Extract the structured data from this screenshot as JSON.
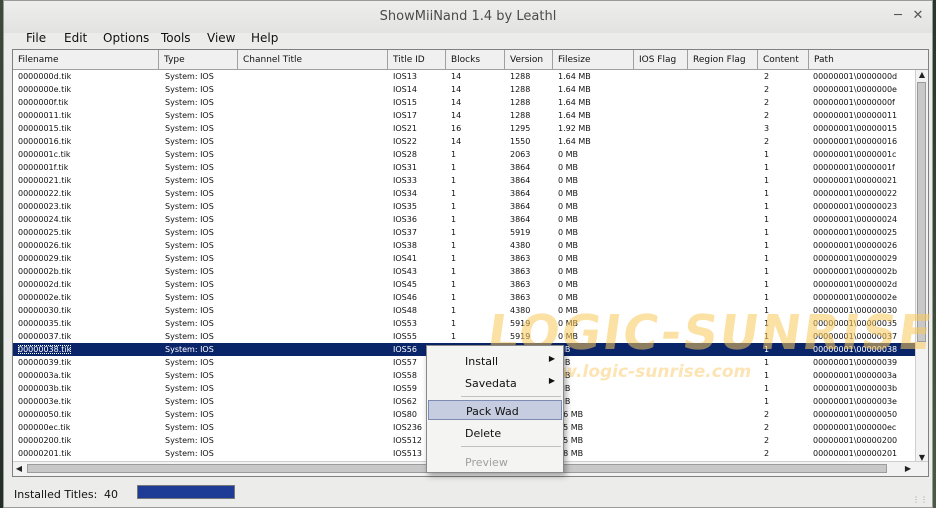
{
  "window": {
    "title": "ShowMiiNand 1.4 by Leathl"
  },
  "menu": [
    "File",
    "Edit",
    "Options",
    "Tools",
    "View",
    "Help"
  ],
  "columns": [
    "Filename",
    "Type",
    "Channel Title",
    "Title ID",
    "Blocks",
    "Version",
    "Filesize",
    "IOS Flag",
    "Region Flag",
    "Content",
    "Path"
  ],
  "rows": [
    {
      "f": "0000000d.tik",
      "t": "System: IOS",
      "ch": "",
      "id": "IOS13",
      "b": "14",
      "v": "1288",
      "s": "1.64 MB",
      "ios": "",
      "reg": "",
      "c": "2",
      "p": "00000001\\0000000d"
    },
    {
      "f": "0000000e.tik",
      "t": "System: IOS",
      "ch": "",
      "id": "IOS14",
      "b": "14",
      "v": "1288",
      "s": "1.64 MB",
      "ios": "",
      "reg": "",
      "c": "2",
      "p": "00000001\\0000000e"
    },
    {
      "f": "0000000f.tik",
      "t": "System: IOS",
      "ch": "",
      "id": "IOS15",
      "b": "14",
      "v": "1288",
      "s": "1.64 MB",
      "ios": "",
      "reg": "",
      "c": "2",
      "p": "00000001\\0000000f"
    },
    {
      "f": "00000011.tik",
      "t": "System: IOS",
      "ch": "",
      "id": "IOS17",
      "b": "14",
      "v": "1288",
      "s": "1.64 MB",
      "ios": "",
      "reg": "",
      "c": "2",
      "p": "00000001\\00000011"
    },
    {
      "f": "00000015.tik",
      "t": "System: IOS",
      "ch": "",
      "id": "IOS21",
      "b": "16",
      "v": "1295",
      "s": "1.92 MB",
      "ios": "",
      "reg": "",
      "c": "3",
      "p": "00000001\\00000015"
    },
    {
      "f": "00000016.tik",
      "t": "System: IOS",
      "ch": "",
      "id": "IOS22",
      "b": "14",
      "v": "1550",
      "s": "1.64 MB",
      "ios": "",
      "reg": "",
      "c": "2",
      "p": "00000001\\00000016"
    },
    {
      "f": "0000001c.tik",
      "t": "System: IOS",
      "ch": "",
      "id": "IOS28",
      "b": "1",
      "v": "2063",
      "s": "0 MB",
      "ios": "",
      "reg": "",
      "c": "1",
      "p": "00000001\\0000001c"
    },
    {
      "f": "0000001f.tik",
      "t": "System: IOS",
      "ch": "",
      "id": "IOS31",
      "b": "1",
      "v": "3864",
      "s": "0 MB",
      "ios": "",
      "reg": "",
      "c": "1",
      "p": "00000001\\0000001f"
    },
    {
      "f": "00000021.tik",
      "t": "System: IOS",
      "ch": "",
      "id": "IOS33",
      "b": "1",
      "v": "3864",
      "s": "0 MB",
      "ios": "",
      "reg": "",
      "c": "1",
      "p": "00000001\\00000021"
    },
    {
      "f": "00000022.tik",
      "t": "System: IOS",
      "ch": "",
      "id": "IOS34",
      "b": "1",
      "v": "3864",
      "s": "0 MB",
      "ios": "",
      "reg": "",
      "c": "1",
      "p": "00000001\\00000022"
    },
    {
      "f": "00000023.tik",
      "t": "System: IOS",
      "ch": "",
      "id": "IOS35",
      "b": "1",
      "v": "3864",
      "s": "0 MB",
      "ios": "",
      "reg": "",
      "c": "1",
      "p": "00000001\\00000023"
    },
    {
      "f": "00000024.tik",
      "t": "System: IOS",
      "ch": "",
      "id": "IOS36",
      "b": "1",
      "v": "3864",
      "s": "0 MB",
      "ios": "",
      "reg": "",
      "c": "1",
      "p": "00000001\\00000024"
    },
    {
      "f": "00000025.tik",
      "t": "System: IOS",
      "ch": "",
      "id": "IOS37",
      "b": "1",
      "v": "5919",
      "s": "0 MB",
      "ios": "",
      "reg": "",
      "c": "1",
      "p": "00000001\\00000025"
    },
    {
      "f": "00000026.tik",
      "t": "System: IOS",
      "ch": "",
      "id": "IOS38",
      "b": "1",
      "v": "4380",
      "s": "0 MB",
      "ios": "",
      "reg": "",
      "c": "1",
      "p": "00000001\\00000026"
    },
    {
      "f": "00000029.tik",
      "t": "System: IOS",
      "ch": "",
      "id": "IOS41",
      "b": "1",
      "v": "3863",
      "s": "0 MB",
      "ios": "",
      "reg": "",
      "c": "1",
      "p": "00000001\\00000029"
    },
    {
      "f": "0000002b.tik",
      "t": "System: IOS",
      "ch": "",
      "id": "IOS43",
      "b": "1",
      "v": "3863",
      "s": "0 MB",
      "ios": "",
      "reg": "",
      "c": "1",
      "p": "00000001\\0000002b"
    },
    {
      "f": "0000002d.tik",
      "t": "System: IOS",
      "ch": "",
      "id": "IOS45",
      "b": "1",
      "v": "3863",
      "s": "0 MB",
      "ios": "",
      "reg": "",
      "c": "1",
      "p": "00000001\\0000002d"
    },
    {
      "f": "0000002e.tik",
      "t": "System: IOS",
      "ch": "",
      "id": "IOS46",
      "b": "1",
      "v": "3863",
      "s": "0 MB",
      "ios": "",
      "reg": "",
      "c": "1",
      "p": "00000001\\0000002e"
    },
    {
      "f": "00000030.tik",
      "t": "System: IOS",
      "ch": "",
      "id": "IOS48",
      "b": "1",
      "v": "4380",
      "s": "0 MB",
      "ios": "",
      "reg": "",
      "c": "1",
      "p": "00000001\\00000030"
    },
    {
      "f": "00000035.tik",
      "t": "System: IOS",
      "ch": "",
      "id": "IOS53",
      "b": "1",
      "v": "5919",
      "s": "0 MB",
      "ios": "",
      "reg": "",
      "c": "1",
      "p": "00000001\\00000035"
    },
    {
      "f": "00000037.tik",
      "t": "System: IOS",
      "ch": "",
      "id": "IOS55",
      "b": "1",
      "v": "5919",
      "s": "0 MB",
      "ios": "",
      "reg": "",
      "c": "1",
      "p": "00000001\\00000037"
    },
    {
      "f": "00000038.tik",
      "t": "System: IOS",
      "ch": "",
      "id": "IOS56",
      "b": "",
      "v": "",
      "s": "MB",
      "ios": "",
      "reg": "",
      "c": "1",
      "p": "00000001\\00000038",
      "sel": true
    },
    {
      "f": "00000039.tik",
      "t": "System: IOS",
      "ch": "",
      "id": "IOS57",
      "b": "",
      "v": "",
      "s": "MB",
      "ios": "",
      "reg": "",
      "c": "1",
      "p": "00000001\\00000039"
    },
    {
      "f": "0000003a.tik",
      "t": "System: IOS",
      "ch": "",
      "id": "IOS58",
      "b": "",
      "v": "",
      "s": "MB",
      "ios": "",
      "reg": "",
      "c": "1",
      "p": "00000001\\0000003a"
    },
    {
      "f": "0000003b.tik",
      "t": "System: IOS",
      "ch": "",
      "id": "IOS59",
      "b": "",
      "v": "",
      "s": "MB",
      "ios": "",
      "reg": "",
      "c": "1",
      "p": "00000001\\0000003b"
    },
    {
      "f": "0000003e.tik",
      "t": "System: IOS",
      "ch": "",
      "id": "IOS62",
      "b": "",
      "v": "",
      "s": "MB",
      "ios": "",
      "reg": "",
      "c": "1",
      "p": "00000001\\0000003e"
    },
    {
      "f": "00000050.tik",
      "t": "System: IOS",
      "ch": "",
      "id": "IOS80",
      "b": "",
      "v": "",
      "s": "16 MB",
      "ios": "",
      "reg": "",
      "c": "2",
      "p": "00000001\\00000050"
    },
    {
      "f": "000000ec.tik",
      "t": "System: IOS",
      "ch": "",
      "id": "IOS236",
      "b": "",
      "v": "",
      "s": "15 MB",
      "ios": "",
      "reg": "",
      "c": "2",
      "p": "00000001\\000000ec"
    },
    {
      "f": "00000200.tik",
      "t": "System: IOS",
      "ch": "",
      "id": "IOS512",
      "b": "",
      "v": "",
      "s": "25 MB",
      "ios": "",
      "reg": "",
      "c": "2",
      "p": "00000001\\00000200"
    },
    {
      "f": "00000201.tik",
      "t": "System: IOS",
      "ch": "",
      "id": "IOS513",
      "b": "",
      "v": "",
      "s": "58 MB",
      "ios": "",
      "reg": "",
      "c": "2",
      "p": "00000001\\00000201"
    }
  ],
  "context_menu": {
    "install": "Install",
    "savedata": "Savedata",
    "pack_wad": "Pack Wad",
    "delete": "Delete",
    "preview": "Preview"
  },
  "status": {
    "label": "Installed Titles:",
    "count": "40"
  },
  "watermark": {
    "main": "LOGIC-SUNRISE",
    "url": "www.logic-sunrise.com"
  },
  "colors": {
    "selection": "#0a246a",
    "menu_highlight": "#c7cde0",
    "progress": "#1e3c96"
  }
}
